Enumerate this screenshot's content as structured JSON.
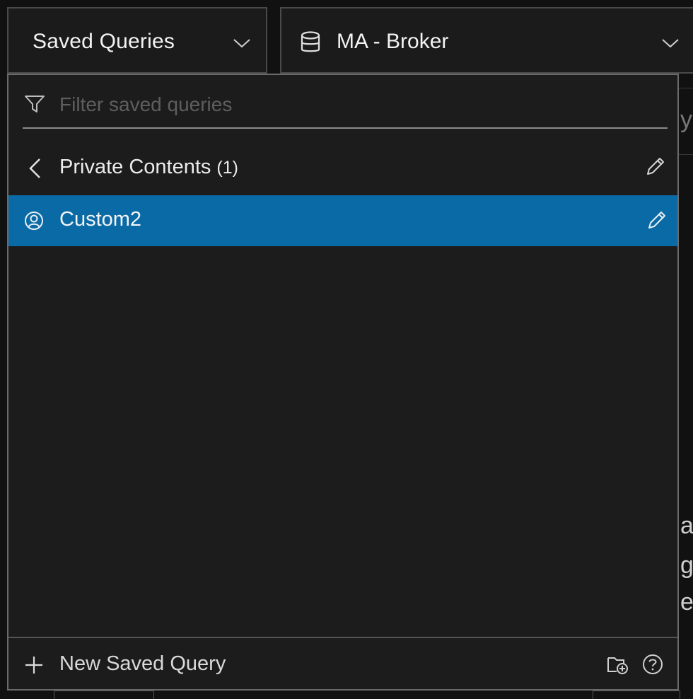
{
  "toolbar": {
    "saved_queries_label": "Saved Queries",
    "service_label": "MA - Broker"
  },
  "panel": {
    "filter_placeholder": "Filter saved queries",
    "folder": {
      "name": "Private Contents",
      "count": "(1)"
    },
    "queries": [
      {
        "label": "Custom2",
        "selected": true
      }
    ],
    "footer": {
      "new_label": "New Saved Query"
    }
  },
  "background_peek": {
    "chars": [
      "y",
      "a",
      "g",
      "e"
    ]
  },
  "colors": {
    "selected_row": "#0a6aa6",
    "panel_bg": "#1c1c1c",
    "text": "#ececec"
  },
  "icons": [
    "chevron-down-icon",
    "database-icon",
    "filter-icon",
    "chevron-left-icon",
    "pencil-icon",
    "user-icon",
    "plus-icon",
    "add-folder-icon",
    "help-icon"
  ]
}
